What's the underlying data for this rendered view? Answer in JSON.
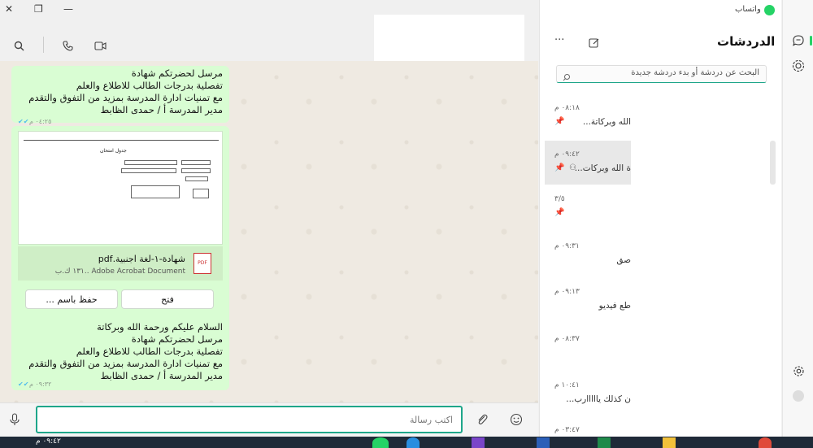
{
  "app": {
    "title": "واتساب",
    "accent": "#25d366"
  },
  "window_controls": {
    "close": "✕",
    "restore": "❐",
    "minimize": "—"
  },
  "chat_header": {
    "search_icon": "search-icon",
    "voice_icon": "phone-icon",
    "video_icon": "video-icon"
  },
  "messages": {
    "first": {
      "lines": [
        "مرسل لحضرتكم شهادة",
        "تفصلية بدرجات الطالب للاطلاع والعلم",
        "مع تمنيات ادارة المدرسة بمزيد من التفوق والتقدم",
        "مدير المدرسة أ / حمدى الظابط"
      ],
      "time": "٠٤:٢٥ م"
    },
    "document": {
      "preview_title": "جدول امتحان",
      "filename": "شهادة-١-لغة اجنبية.pdf",
      "meta": "١٣١ ك.ب.. Adobe Acrobat Document",
      "file_badge": "PDF",
      "open_label": "فتح",
      "save_label": "حفظ باسم ..."
    },
    "second": {
      "lines": [
        "السلام عليكم ورحمة الله وبركاتة",
        "مرسل لحضرتكم شهادة",
        "تفصلية بدرجات الطالب للاطلاع والعلم",
        "مع تمنيات ادارة المدرسة بمزيد من التفوق والتقدم",
        "مدير المدرسة أ / حمدى الظابط"
      ],
      "time": "٠٩:٣٢ م"
    }
  },
  "composer": {
    "placeholder": "اكتب رسالة"
  },
  "chats_panel": {
    "title": "الدردشات",
    "search_placeholder": "البحث عن دردشة أو بدء دردشة جديدة",
    "items": [
      {
        "time": "٠٨:١٨ م",
        "preview": "الله وبركاتة..."
      },
      {
        "time": "٠٩:٤٢ م",
        "preview": "ة الله وبركات..."
      },
      {
        "time": "٣/٥",
        "preview": ""
      },
      {
        "time": "٠٩:٣١ م",
        "preview": "صق"
      },
      {
        "time": "٠٩:١٣ م",
        "preview": "طع فيديو"
      },
      {
        "time": "٠٨:٣٧ م",
        "preview": ""
      },
      {
        "time": "١٠:٤١ م",
        "preview": "ن كذلك يااااارب..."
      },
      {
        "time": "٠٣:٤٧ م",
        "preview": ""
      }
    ]
  },
  "taskbar": {
    "clock": "٠٩:٤٢ م"
  }
}
